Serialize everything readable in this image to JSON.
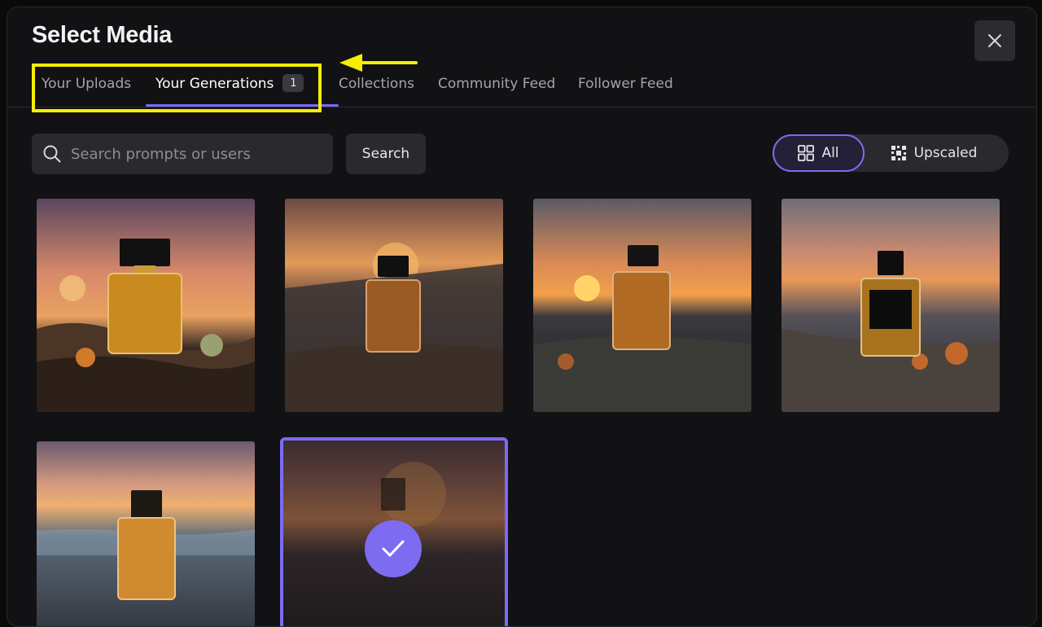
{
  "modal": {
    "title": "Select Media",
    "close_icon": "close-icon"
  },
  "tabs": [
    {
      "label": "Your Uploads",
      "active": false
    },
    {
      "label": "Your Generations",
      "active": true,
      "badge": "1"
    },
    {
      "label": "Collections",
      "active": false
    },
    {
      "label": "Community Feed",
      "active": false
    },
    {
      "label": "Follower Feed",
      "active": false
    }
  ],
  "annotation": {
    "highlight_color": "#f6ef00"
  },
  "search": {
    "placeholder": "Search prompts or users",
    "value": "",
    "button_label": "Search",
    "icon": "search-icon"
  },
  "filter": {
    "all_label": "All",
    "all_icon": "grid-icon",
    "upscaled_label": "Upscaled",
    "upscaled_icon": "upscale-icon",
    "selected": "All"
  },
  "accent_color": "#7c6bf2",
  "gallery": {
    "items": [
      {
        "scene": "perfume-bottle-on-driftwood-sunset",
        "selected": false
      },
      {
        "scene": "perfume-bottle-on-log-blurred-sunset",
        "selected": false
      },
      {
        "scene": "perfume-bottle-on-mossy-rock-sunset",
        "selected": false
      },
      {
        "scene": "perfume-bottle-black-label-on-rock",
        "selected": false
      },
      {
        "scene": "perfume-bottle-on-beach-sunset",
        "selected": false
      },
      {
        "scene": "perfume-bottle-dusk-selected",
        "selected": true
      }
    ],
    "check_icon": "checkmark-icon"
  }
}
